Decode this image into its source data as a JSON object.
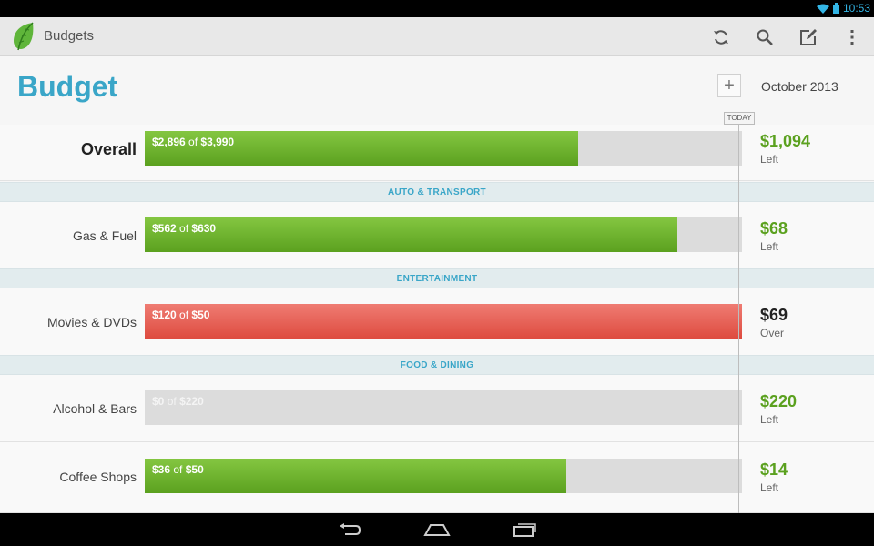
{
  "status": {
    "time": "10:53"
  },
  "actionbar": {
    "title": "Budgets",
    "icons": [
      "sync-icon",
      "search-icon",
      "edit-icon",
      "overflow-menu-icon"
    ]
  },
  "page": {
    "title": "Budget",
    "month": "October 2013",
    "add_label": "+",
    "today_label": "TODAY"
  },
  "overall": {
    "label": "Overall",
    "spent": "$2,896",
    "of": "of",
    "budget": "$3,990",
    "progress": 0.726,
    "amount": "$1,094",
    "status": "Left"
  },
  "sections": [
    {
      "title": "AUTO & TRANSPORT",
      "items": [
        {
          "label": "Gas & Fuel",
          "spent": "$562",
          "of": "of",
          "budget": "$630",
          "progress": 0.892,
          "amount": "$68",
          "status": "Left"
        }
      ]
    },
    {
      "title": "ENTERTAINMENT",
      "items": [
        {
          "label": "Movies & DVDs",
          "spent": "$120",
          "of": "of",
          "budget": "$50",
          "progress": 1.0,
          "amount": "$69",
          "status": "Over"
        }
      ]
    },
    {
      "title": "FOOD & DINING",
      "items": [
        {
          "label": "Alcohol & Bars",
          "spent": "$0",
          "of": "of",
          "budget": "$220",
          "progress": 0.0,
          "amount": "$220",
          "status": "Left"
        },
        {
          "label": "Coffee Shops",
          "spent": "$36",
          "of": "of",
          "budget": "$50",
          "progress": 0.706,
          "amount": "$14",
          "status": "Left"
        }
      ]
    }
  ],
  "colors": {
    "accent": "#3aa6c8",
    "good": "#5ba11f",
    "over": "#de4b3f"
  }
}
